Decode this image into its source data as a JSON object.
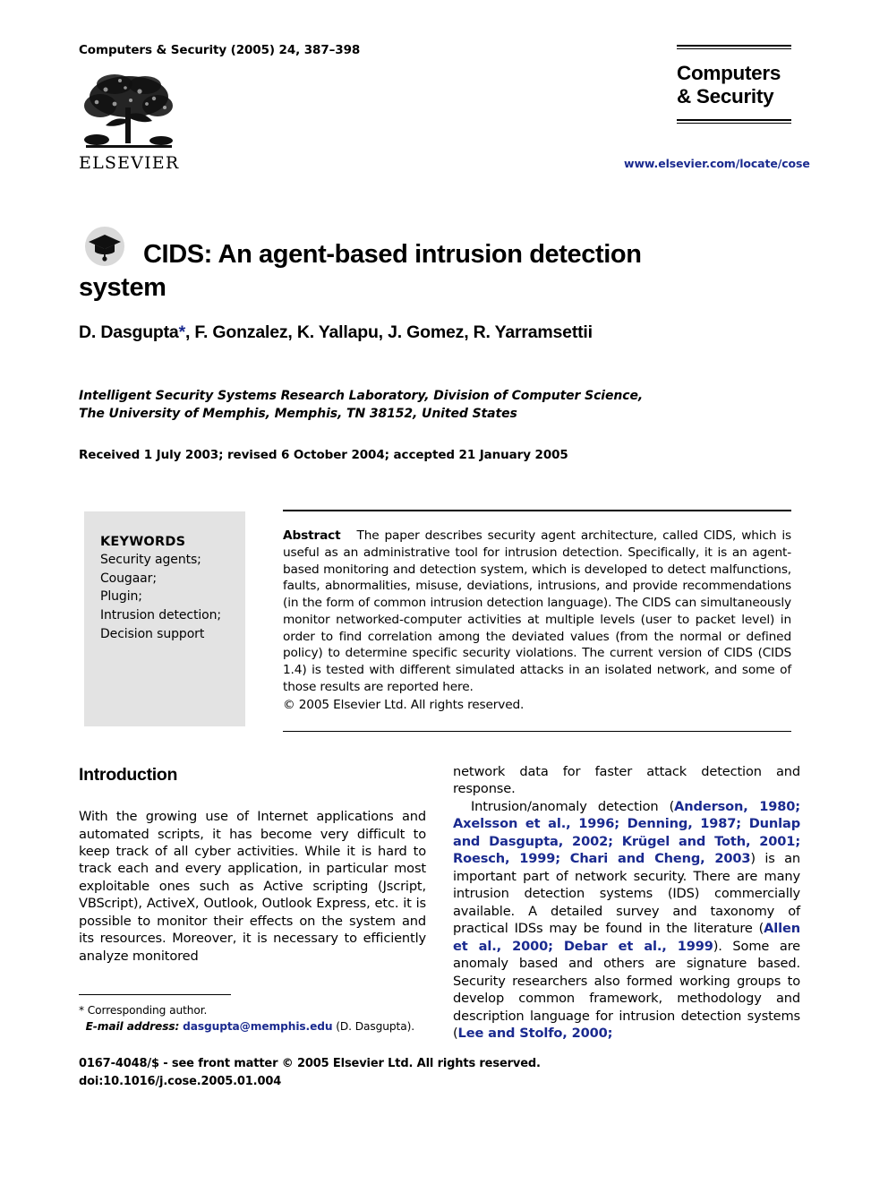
{
  "header": {
    "journal_ref": "Computers & Security (2005) 24, 387–398",
    "publisher_logo_text": "ELSEVIER",
    "publisher_logo_icon": "elsevier-tree-logo",
    "brand_line1": "Computers",
    "brand_line2": "& Security",
    "brand_url": "www.elsevier.com/locate/cose"
  },
  "article": {
    "title_icon": "graduation-cap-icon",
    "title": "CIDS: An agent-based intrusion detection system",
    "authors": "D. Dasgupta",
    "author_marker": "*",
    "authors_rest": ", F. Gonzalez, K. Yallapu, J. Gomez, R. Yarramsettii",
    "affiliation_line1": "Intelligent Security Systems Research Laboratory, Division of Computer Science,",
    "affiliation_line2": "The University of Memphis, Memphis, TN 38152, United States",
    "dates": "Received 1 July 2003; revised 6 October 2004; accepted 21 January 2005"
  },
  "keywords": {
    "heading": "KEYWORDS",
    "items": [
      "Security agents;",
      "Cougaar;",
      "Plugin;",
      "Intrusion detection;",
      "Decision support"
    ]
  },
  "abstract": {
    "label": "Abstract",
    "text": "The paper describes security agent architecture, called CIDS, which is useful as an administrative tool for intrusion detection. Specifically, it is an agent-based monitoring and detection system, which is developed to detect malfunctions, faults, abnormalities, misuse, deviations, intrusions, and provide recommendations (in the form of common intrusion detection language). The CIDS can simultaneously monitor networked-computer activities at multiple levels (user to packet level) in order to find correlation among the deviated values (from the normal or defined policy) to determine specific security violations. The current version of CIDS (CIDS 1.4) is tested with different simulated attacks in an isolated network, and some of those results are reported here.",
    "copyright": "© 2005 Elsevier Ltd. All rights reserved."
  },
  "body": {
    "section_heading": "Introduction",
    "left_paragraph": "With the growing use of Internet applications and automated scripts, it has become very difficult to keep track of all cyber activities. While it is hard to track each and every application, in particular most exploitable ones such as Active scripting (Jscript, VBScript), ActiveX, Outlook, Outlook Express, etc. it is possible to monitor their effects on the system and its resources. Moreover, it is necessary to efficiently analyze monitored",
    "right_paragraph_1": "network data for faster attack detection and response.",
    "right_p2_pre": "Intrusion/anomaly detection (",
    "right_p2_cite1": "Anderson, 1980; Axelsson et al., 1996; Denning, 1987; Dunlap and Dasgupta, 2002; Krügel and Toth, 2001; Roesch, 1999; Chari and Cheng, 2003",
    "right_p2_mid": ") is an important part of network security. There are many intrusion detection systems (IDS) commercially available. A detailed survey and taxonomy of practical IDSs may be found in the literature (",
    "right_p2_cite2": "Allen et al., 2000; Debar et al., 1999",
    "right_p2_mid2": "). Some are anomaly based and others are signature based. Security researchers also formed working groups to develop common framework, methodology and description language for intrusion detection systems (",
    "right_p2_cite3": "Lee and Stolfo, 2000;"
  },
  "footnote": {
    "corresponding": "* Corresponding author.",
    "email_label": "E-mail address:",
    "email": "dasgupta@memphis.edu",
    "email_suffix": "(D. Dasgupta)."
  },
  "footer": {
    "issn_line": "0167-4048/$ - see front matter © 2005 Elsevier Ltd. All rights reserved.",
    "doi_line": "doi:10.1016/j.cose.2005.01.004"
  },
  "colors": {
    "link": "#1a2a8f",
    "keyword_box_bg": "#e3e3e3"
  }
}
